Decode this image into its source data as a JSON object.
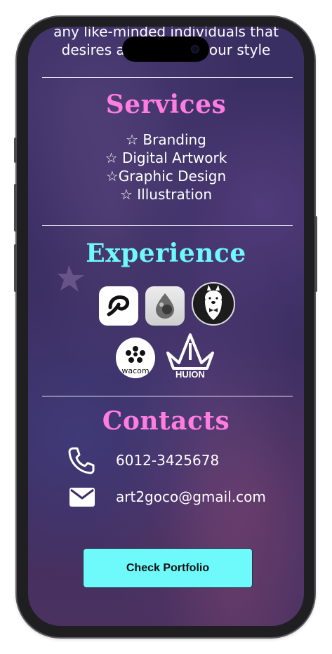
{
  "intro": {
    "line1": "any like-minded individuals that",
    "line2": "desires a [obscured] our style"
  },
  "services": {
    "title": "Services",
    "items": [
      "☆ Branding",
      "☆ Digital Artwork",
      "☆Graphic Design",
      "☆ Illustration"
    ]
  },
  "experience": {
    "title": "Experience",
    "logos": [
      {
        "name": "clip-studio-logo"
      },
      {
        "name": "procreate-style-logo"
      },
      {
        "name": "alpaca-mascot-logo"
      },
      {
        "name": "wacom-logo",
        "text": "wacom"
      },
      {
        "name": "huion-logo",
        "text": "HUION"
      }
    ]
  },
  "contacts": {
    "title": "Contacts",
    "phone": "6012-3425678",
    "email": "art2goco@gmail.com"
  },
  "cta": {
    "label": "Check Portfolio"
  },
  "colors": {
    "services_heading": "#ff7ce0",
    "experience_heading": "#6ef9fb",
    "contacts_heading": "#ff7ce0",
    "button_bg": "#6ef9fb",
    "background": "#3c2f64"
  }
}
